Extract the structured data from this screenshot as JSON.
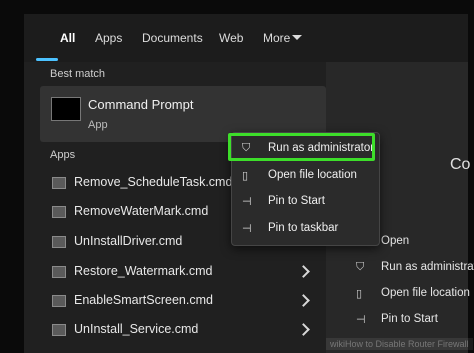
{
  "tabs": [
    "All",
    "Apps",
    "Documents",
    "Web",
    "More"
  ],
  "best_match": {
    "heading": "Best match",
    "title": "Command Prompt",
    "subtitle": "App"
  },
  "apps": {
    "heading": "Apps",
    "items": [
      "Remove_ScheduleTask.cmd",
      "RemoveWaterMark.cmd",
      "UnInstallDriver.cmd",
      "Restore_Watermark.cmd",
      "EnableSmartScreen.cmd",
      "UnInstall_Service.cmd"
    ]
  },
  "context_menu": {
    "items": [
      {
        "label": "Run as administrator",
        "icon": "shield-icon"
      },
      {
        "label": "Open file location",
        "icon": "folder-icon"
      },
      {
        "label": "Pin to Start",
        "icon": "pin-icon"
      },
      {
        "label": "Pin to taskbar",
        "icon": "pin-icon"
      }
    ],
    "highlight_color": "#3dde2a"
  },
  "right_panel": {
    "title_partial": "Co",
    "items": [
      {
        "label": "Open",
        "icon": "open-icon"
      },
      {
        "label": "Run as administrat",
        "icon": "shield-icon"
      },
      {
        "label": "Open file location",
        "icon": "folder-icon"
      },
      {
        "label": "Pin to Start",
        "icon": "pin-icon"
      }
    ]
  },
  "watermark": "wikiHow to Disable Router Firewall",
  "colors": {
    "accent": "#4cc2ff",
    "highlight": "#3dde2a",
    "panel": "#202020"
  }
}
